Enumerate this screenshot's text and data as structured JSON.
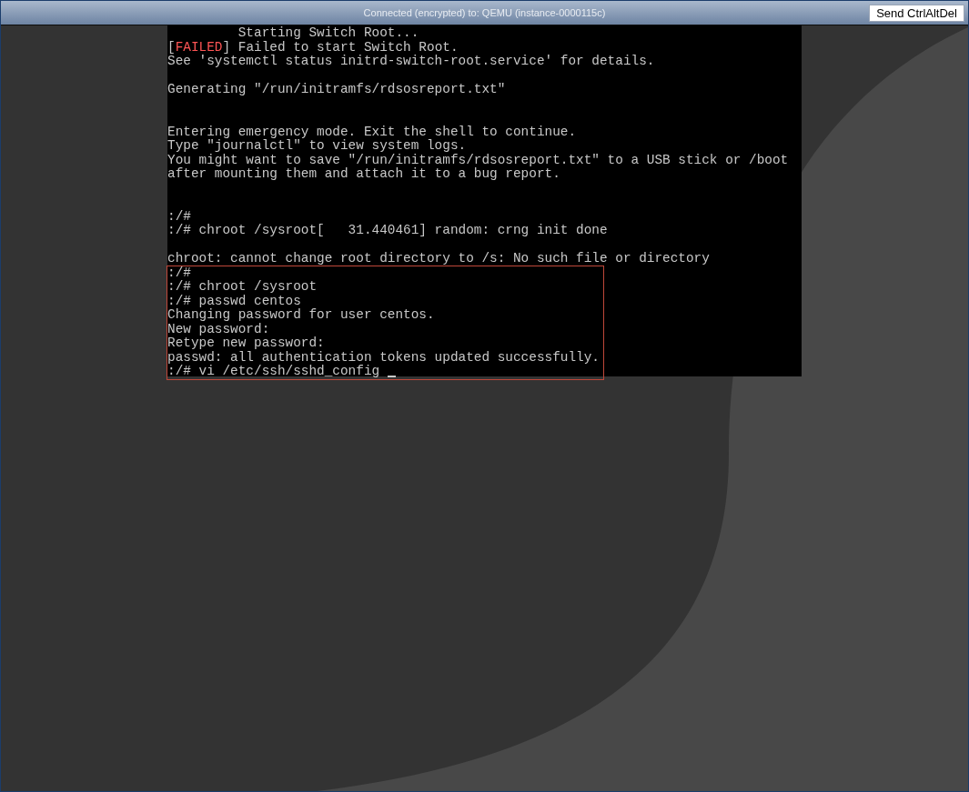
{
  "title_bar": {
    "title": "Connected (encrypted) to: QEMU (instance-0000115c)",
    "button": "Send CtrlAltDel"
  },
  "console": {
    "blocks": [
      {
        "highlighted": false,
        "lines": [
          {
            "kind": "plain",
            "text": "         Starting Switch Root..."
          },
          {
            "kind": "status",
            "bracket_open": "[",
            "status": "FAILED",
            "bracket_close": "]",
            "text": " Failed to start Switch Root."
          },
          {
            "kind": "plain",
            "text": "See 'systemctl status initrd-switch-root.service' for details."
          },
          {
            "kind": "blank"
          }
        ]
      },
      {
        "highlighted": false,
        "lines": [
          {
            "kind": "plain",
            "text": "Generating \"/run/initramfs/rdsosreport.txt\""
          },
          {
            "kind": "blank"
          },
          {
            "kind": "blank"
          }
        ]
      },
      {
        "highlighted": false,
        "lines": [
          {
            "kind": "plain",
            "text": "Entering emergency mode. Exit the shell to continue."
          },
          {
            "kind": "plain",
            "text": "Type \"journalctl\" to view system logs."
          },
          {
            "kind": "plain",
            "text": "You might want to save \"/run/initramfs/rdsosreport.txt\" to a USB stick or /boot"
          },
          {
            "kind": "plain",
            "text": "after mounting them and attach it to a bug report."
          },
          {
            "kind": "blank"
          },
          {
            "kind": "blank"
          }
        ]
      },
      {
        "highlighted": false,
        "lines": [
          {
            "kind": "plain",
            "text": ":/#"
          },
          {
            "kind": "plain",
            "text": ":/# chroot /sysroot[   31.440461] random: crng init done"
          },
          {
            "kind": "blank"
          }
        ]
      },
      {
        "highlighted": false,
        "lines": [
          {
            "kind": "plain",
            "text": "chroot: cannot change root directory to /s: No such file or directory"
          }
        ]
      },
      {
        "highlighted": true,
        "lines": [
          {
            "kind": "plain",
            "text": ":/#"
          },
          {
            "kind": "plain",
            "text": ":/# chroot /sysroot"
          },
          {
            "kind": "plain",
            "text": ":/# passwd centos"
          },
          {
            "kind": "plain",
            "text": "Changing password for user centos."
          },
          {
            "kind": "plain",
            "text": "New password:"
          },
          {
            "kind": "plain",
            "text": "Retype new password:"
          },
          {
            "kind": "plain",
            "text": "passwd: all authentication tokens updated successfully."
          },
          {
            "kind": "cursor",
            "text": ":/# vi /etc/ssh/sshd_config "
          }
        ]
      }
    ]
  }
}
